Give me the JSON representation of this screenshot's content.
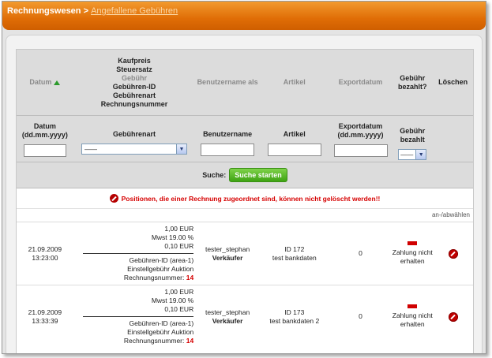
{
  "header": {
    "title": "Rechnungswesen >",
    "current_page": "Angefallene Gebühren"
  },
  "columns": {
    "datum": "Datum",
    "fees": [
      "Kaufpreis",
      "Steuersatz",
      "Gebühr",
      "Gebühren-ID",
      "Gebührenart",
      "Rechnungsnummer"
    ],
    "benutzername": "Benutzername als",
    "artikel": "Artikel",
    "exportdatum": "Exportdatum",
    "gebuehr_bezahlt": "Gebühr bezahlt?",
    "loeschen": "Löschen"
  },
  "filters": {
    "datum": "Datum (dd.mm.yyyy)",
    "gebuehrenart": "Gebührenart",
    "gebuehrenart_value": "——",
    "benutzername": "Benutzername",
    "artikel": "Artikel",
    "exportdatum": "Exportdatum (dd.mm.yyyy)",
    "gebuehr_bezahlt": "Gebühr bezahlt",
    "gebuehr_bezahlt_value": "——"
  },
  "search": {
    "label": "Suche:",
    "button": "Suche starten"
  },
  "warning": "Positionen, die einer Rechnung zugeordnet sind, können nicht gelöscht werden!!",
  "select_toggle": "an-/abwählen",
  "rows": [
    {
      "date": "21.09.2009",
      "time": "13:23:00",
      "price": "1,00 EUR",
      "tax": "Mwst 19.00 %",
      "fee": "0,10 EUR",
      "fee_id": "Gebühren-ID (area-1)",
      "fee_type": "Einstellgebühr Auktion",
      "invoice_label": "Rechnungsnummer:",
      "invoice_no": "14",
      "user": "tester_stephan",
      "role": "Verkäufer",
      "article_id": "ID 172",
      "article_name": "test bankdaten",
      "export": "0",
      "payment": "Zahlung nicht erhalten"
    },
    {
      "date": "21.09.2009",
      "time": "13:33:39",
      "price": "1,00 EUR",
      "tax": "Mwst 19.00 %",
      "fee": "0,10 EUR",
      "fee_id": "Gebühren-ID (area-1)",
      "fee_type": "Einstellgebühr Auktion",
      "invoice_label": "Rechnungsnummer:",
      "invoice_no": "14",
      "user": "tester_stephan",
      "role": "Verkäufer",
      "article_id": "ID 173",
      "article_name": "test bankdaten 2",
      "export": "0",
      "payment": "Zahlung nicht erhalten"
    }
  ]
}
